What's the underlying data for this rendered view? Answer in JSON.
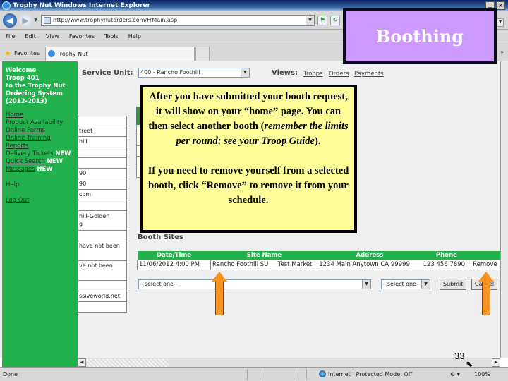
{
  "window": {
    "title": "Trophy Nut  Windows Internet Explorer",
    "url": "http://www.trophynutorders.com/FrMain.asp"
  },
  "menu": [
    "File",
    "Edit",
    "View",
    "Favorites",
    "Tools",
    "Help"
  ],
  "favorites": {
    "label": "Favorites",
    "tab_title": "Trophy Nut"
  },
  "sidebar": {
    "welcome_lines": [
      "Welcome",
      "Troop 401",
      "to the Trophy Nut",
      "Ordering System",
      "(2012-2013)"
    ],
    "links": [
      {
        "label": "Home",
        "badge": ""
      },
      {
        "label": "Product Availability",
        "badge": ""
      },
      {
        "label": "Online Forms",
        "badge": ""
      },
      {
        "label": "Online Training",
        "badge": ""
      },
      {
        "label": "Reports",
        "badge": ""
      },
      {
        "label": "Delivery Tickets",
        "badge": "NEW"
      },
      {
        "label": "Quick Search",
        "badge": "NEW"
      },
      {
        "label": "Messages",
        "badge": "NEW"
      }
    ],
    "help": "Help",
    "logout": "Log Out"
  },
  "left_fragments": [
    "",
    "treet",
    "hill",
    "",
    "",
    "90",
    "90",
    "com",
    "",
    "hill-Golden\ng",
    "",
    "have not been",
    "ve not been",
    "",
    "ssiveworld.net",
    ""
  ],
  "header": {
    "service_unit_label": "Service Unit:",
    "service_unit_value": "400 - Rancho Foothill",
    "views_label": "Views:",
    "views_links": [
      "Troops",
      "Orders",
      "Payments"
    ]
  },
  "booth": {
    "title": "Booth Sites",
    "columns": [
      "Date/Time",
      "Site Name",
      "Address",
      "Phone",
      ""
    ],
    "rows": [
      {
        "datetime": "11/06/2012  4:00  PM",
        "site": "Rancho Foothill SU",
        "site2": "Test Market",
        "address": "1234 Main  Anytown  CA  99999",
        "phone": "123 456 7890",
        "action": "Remove"
      }
    ],
    "site_select": "--select one--",
    "time_select": "--select one--",
    "submit": "Submit",
    "cancel": "Cancel"
  },
  "overlay": {
    "title": "Boothing",
    "callout_p1_a": "After you have submitted your booth request, it will show on your “home” page. You can then select another booth (",
    "callout_p1_em": "remember the limits per round; see your Troop Guide",
    "callout_p1_b": ").",
    "callout_p2": "If you need to remove yourself from a selected booth, click “Remove” to remove it from your schedule.",
    "slide_number": "33"
  },
  "status": {
    "left": "Done",
    "zone": "Internet | Protected Mode: Off",
    "zoom": "100%"
  }
}
